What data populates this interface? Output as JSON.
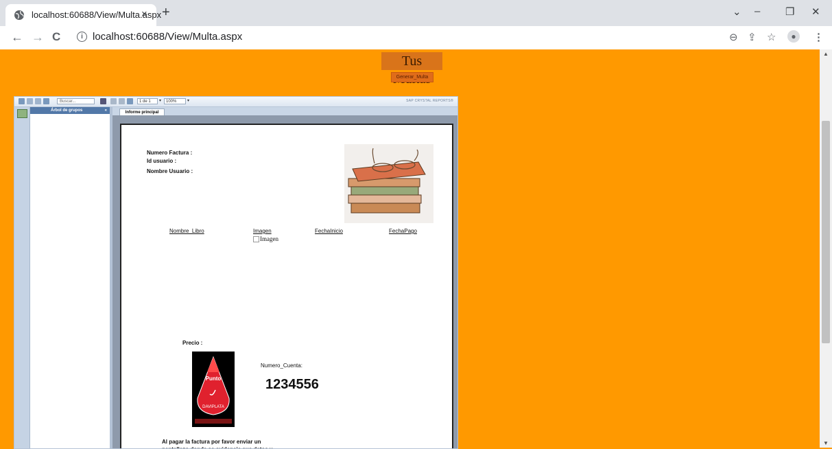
{
  "browser": {
    "tab_title": "localhost:60688/View/Multa.aspx",
    "tab_close": "×",
    "new_tab": "+",
    "url": "localhost:60688/View/Multa.aspx",
    "window_controls": {
      "dropdown": "⌄",
      "minimize": "–",
      "restore": "❐",
      "close": "✕"
    },
    "nav": {
      "back": "←",
      "forward": "→",
      "reload": "C"
    }
  },
  "page": {
    "heading": "Tus Multas",
    "generate_button": "Generar_Multa"
  },
  "viewer": {
    "search_placeholder": "Buscar...",
    "page_indicator": "1 de 1",
    "zoom": "100%",
    "brand": "SAP CRYSTAL REPORTS®",
    "group_tree_title": "Árbol de grupos",
    "collapse_glyph": "«",
    "tab_label": "Informe principal"
  },
  "report": {
    "fields": [
      "Numero Factura :",
      "Id usuario :",
      "Nombre Usuario :"
    ],
    "columns": [
      "Nombre_Libro",
      "Imagen",
      "FechaInicio",
      "FechaPago"
    ],
    "broken_image_alt": "Imagen",
    "price_label": "Precio :",
    "account_label": "Numero_Cuenta:",
    "account_number": "1234556",
    "logo_text_top": "Punto",
    "logo_text_bottom": "DAVIPLATA",
    "footnote": "Al pagar la factura por favor enviar un pantallazo donde se evidencie sus datos y"
  }
}
